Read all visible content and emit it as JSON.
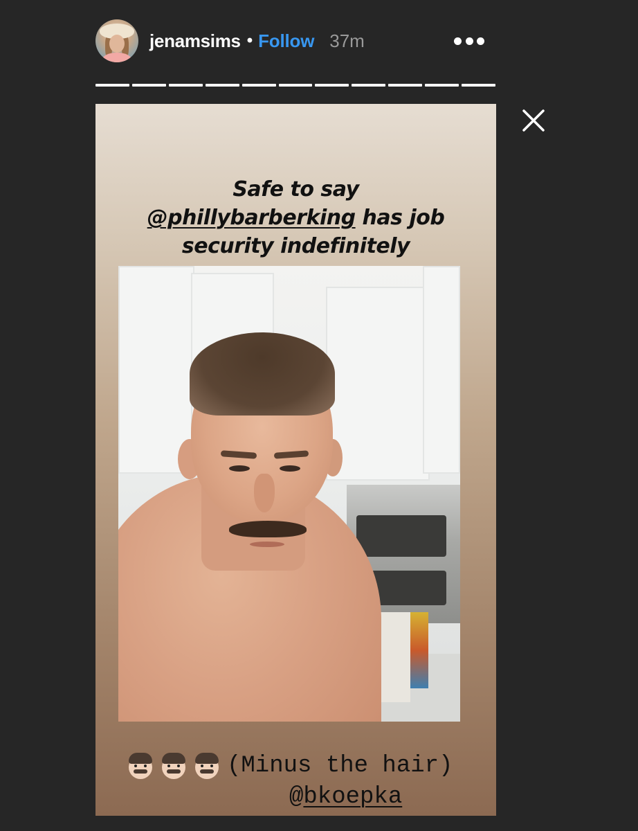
{
  "header": {
    "username": "jenamsims",
    "separator": "•",
    "follow_label": "Follow",
    "time_ago": "37m",
    "progress_segments": 11
  },
  "story": {
    "caption_line1": "Safe to say",
    "caption_mention": "@phillybarberking",
    "caption_line2_rest": " has job",
    "caption_line3": "security indefinitely",
    "bottom_emoji": "man-with-mustache-emoji",
    "bottom_emoji_count": 3,
    "bottom_text": "(Minus the hair)",
    "bottom_mention_at": "@",
    "bottom_mention_name": "bkoepka"
  },
  "icons": {
    "more": "more-horizontal-icon",
    "close": "close-icon"
  },
  "colors": {
    "background": "#262626",
    "follow": "#3897f0",
    "text": "#ffffff",
    "time": "#9a9a9a"
  }
}
